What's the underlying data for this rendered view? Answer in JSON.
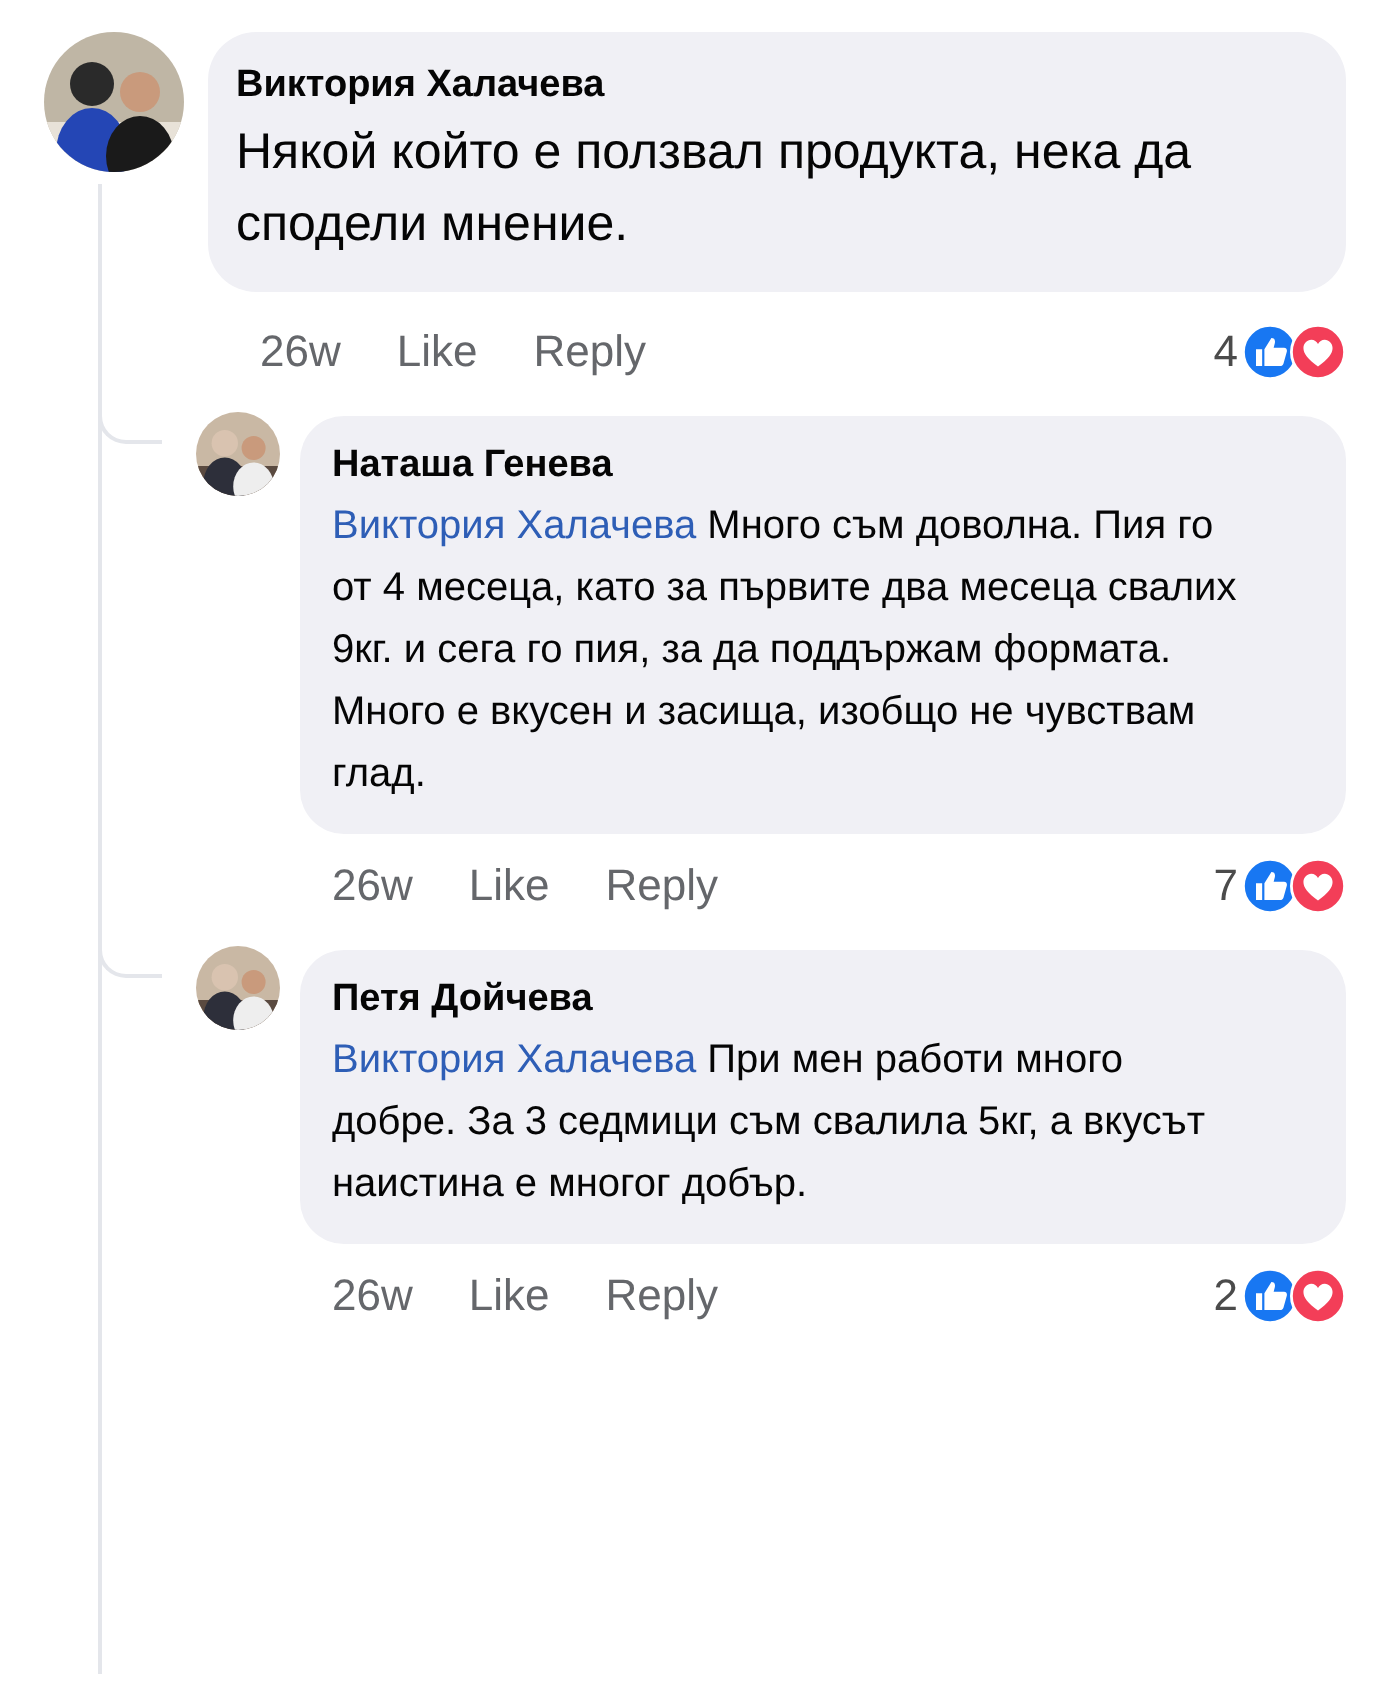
{
  "comment": {
    "author": "Виктория Халачева",
    "text": "Някой който е ползвал продукта, нека да сподели мнение.",
    "time": "26w",
    "like": "Like",
    "reply": "Reply",
    "reaction_count": "4",
    "reactions": [
      {
        "kind": "like"
      },
      {
        "kind": "love"
      }
    ]
  },
  "replies": [
    {
      "author": "Наташа Генева",
      "mention": "Виктория Халачева",
      "text": "Много съм доволна. Пия го от 4 месеца, като за първите два месеца свалих 9кг. и сега го пия, за да поддържам формата. Много е вкусен и засища, изобщо не чувствам глад.",
      "time": "26w",
      "like": "Like",
      "reply": "Reply",
      "reaction_count": "7",
      "reactions": [
        {
          "kind": "like"
        },
        {
          "kind": "love"
        }
      ]
    },
    {
      "author": "Петя Дойчева",
      "mention": "Виктория Халачева",
      "text": "При мен работи много добре. За 3 седмици съм свалила 5кг, а вкусът наистина е многог добър.",
      "time": "26w",
      "like": "Like",
      "reply": "Reply",
      "reaction_count": "2",
      "reactions": [
        {
          "kind": "like"
        },
        {
          "kind": "love"
        }
      ]
    }
  ]
}
